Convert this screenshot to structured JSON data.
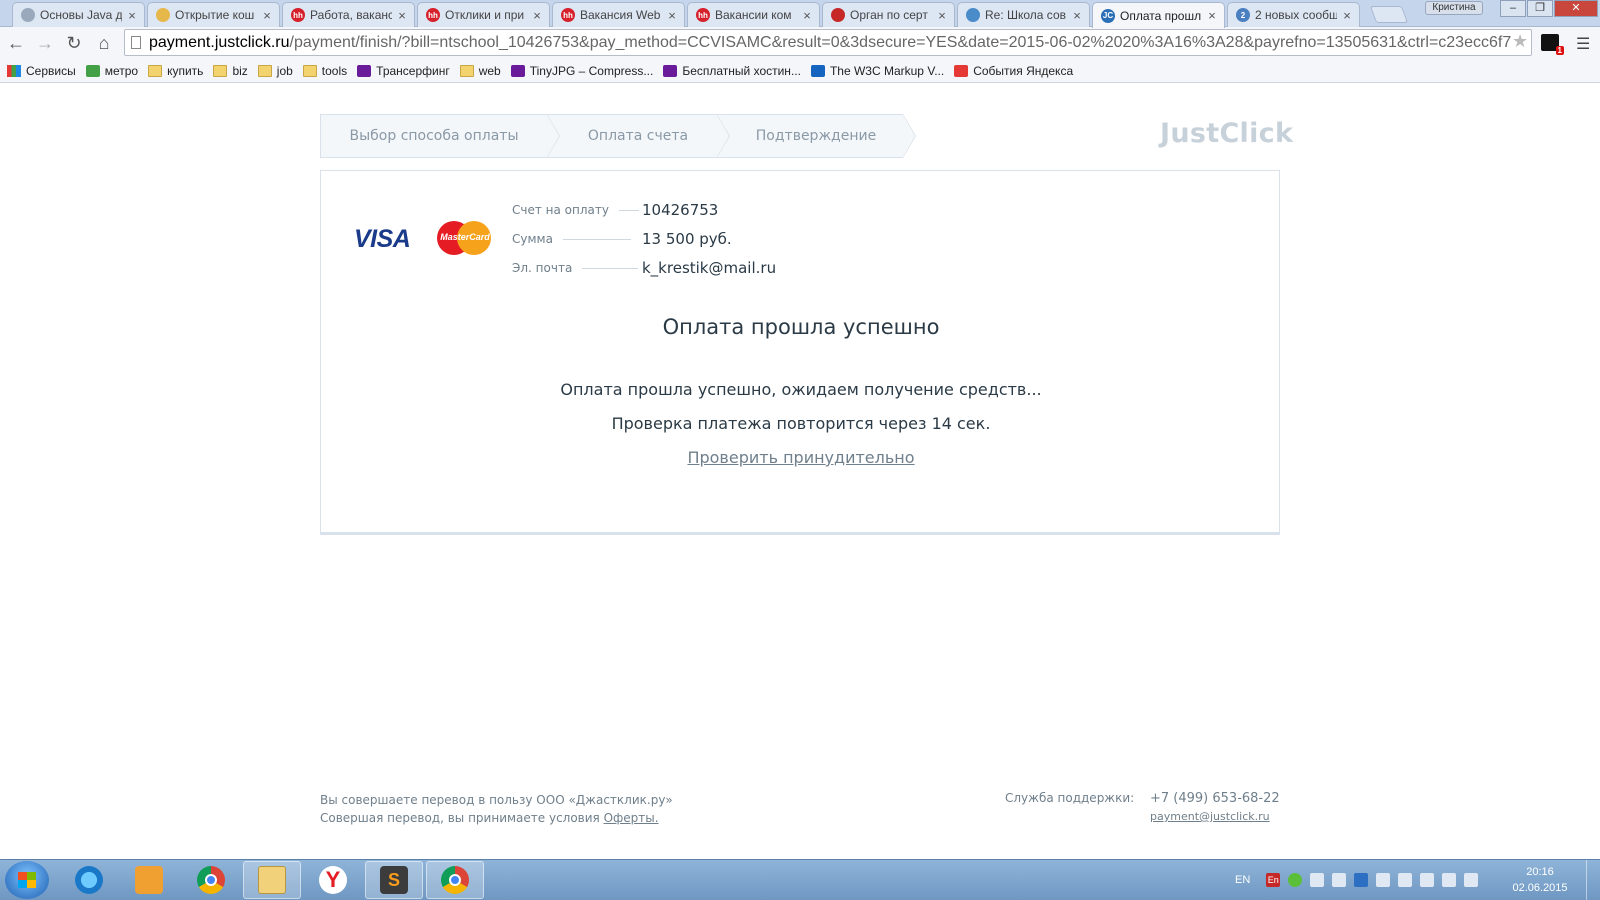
{
  "browser": {
    "tabs": [
      {
        "title": "Основы Java д",
        "favicon_color": "#9aa9bb",
        "fav": ""
      },
      {
        "title": "Открытие кош",
        "favicon_color": "#e6b84a",
        "fav": ""
      },
      {
        "title": "Работа, ваканс",
        "favicon_color": "#d6202b",
        "fav": "hh"
      },
      {
        "title": "Отклики и при",
        "favicon_color": "#d6202b",
        "fav": "hh"
      },
      {
        "title": "Вакансия Web",
        "favicon_color": "#d6202b",
        "fav": "hh"
      },
      {
        "title": "Вакансии ком",
        "favicon_color": "#d6202b",
        "fav": "hh"
      },
      {
        "title": "Орган по серт",
        "favicon_color": "#c62828",
        "fav": ""
      },
      {
        "title": "Re: Школа сов",
        "favicon_color": "#4a8bc9",
        "fav": ""
      },
      {
        "title": "Оплата прошл",
        "favicon_color": "#2a6fb5",
        "fav": "JC"
      },
      {
        "title": "2 новых сообщ",
        "favicon_color": "#4a7fc0",
        "fav": "2"
      }
    ],
    "active_tab_index": 8,
    "user_name": "Кристина",
    "url_host": "payment.justclick.ru",
    "url_rest": "/payment/finish/?bill=ntschool_10426753&pay_method=CCVISAMC&result=0&3dsecure=YES&date=2015-06-02%2020%3A16%3A28&payrefno=13505631&ctrl=c23ecc6f7",
    "ext_badge": "1",
    "bookmarks": [
      {
        "label": "Сервисы",
        "icon": "apps"
      },
      {
        "label": "метро",
        "icon": "metro"
      },
      {
        "label": "купить",
        "icon": "folder"
      },
      {
        "label": "biz",
        "icon": "folder"
      },
      {
        "label": "job",
        "icon": "folder"
      },
      {
        "label": "tools",
        "icon": "folder"
      },
      {
        "label": "Трансерфинг",
        "icon": "site"
      },
      {
        "label": "web",
        "icon": "folder"
      },
      {
        "label": "TinyJPG – Compress...",
        "icon": "site"
      },
      {
        "label": "Бесплатный хостин...",
        "icon": "site"
      },
      {
        "label": "The W3C Markup V...",
        "icon": "w3c"
      },
      {
        "label": "События Яндекса",
        "icon": "yandex"
      }
    ]
  },
  "page": {
    "steps": [
      "Выбор способа оплаты",
      "Оплата счета",
      "Подтверждение"
    ],
    "logo": "JustClick",
    "card_brands": {
      "visa": "VISA",
      "mastercard": "MasterCard"
    },
    "info": [
      {
        "label": "Счет на оплату",
        "value": "10426753"
      },
      {
        "label": "Сумма",
        "value": "13 500 руб."
      },
      {
        "label": "Эл. почта",
        "value": "k_krestik@mail.ru"
      }
    ],
    "success_title": "Оплата прошла успешно",
    "message1": "Оплата прошла успешно, ожидаем получение средств...",
    "message2": "Проверка платежа повторится через 14 сек.",
    "check_link": "Проверить принудительно",
    "footer": {
      "line1": "Вы совершаете перевод в пользу ООО «Джастклик.ру»",
      "line2_prefix": "Совершая перевод, вы принимаете условия ",
      "line2_link": "Оферты.",
      "support_label": "Служба поддержки:",
      "phone": "+7 (499) 653-68-22",
      "email": "payment@justclick.ru"
    }
  },
  "taskbar": {
    "lang": "EN",
    "tray_en": "En",
    "time": "20:16",
    "date": "02.06.2015"
  }
}
